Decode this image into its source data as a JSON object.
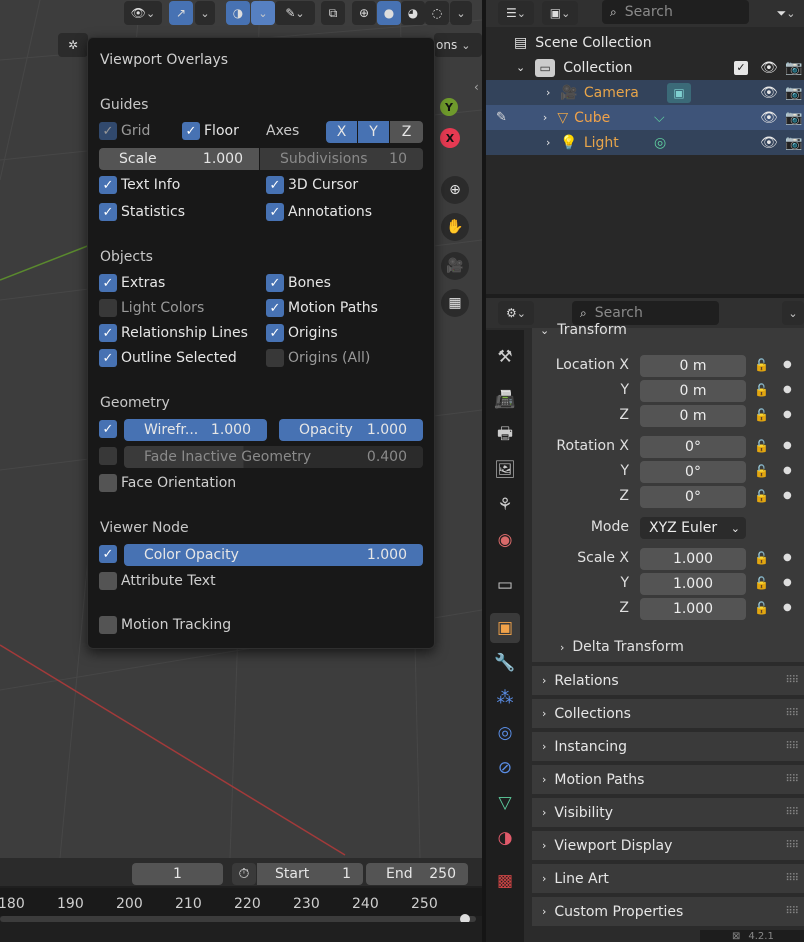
{
  "viewport": {
    "gizmo_y": "Y",
    "gizmo_x": "X",
    "options_label": "ons",
    "colors": {
      "accent": "#4772b3",
      "grid_red": "#a23a3a",
      "grid_green": "#5a8a2e"
    }
  },
  "overlay": {
    "title": "Viewport Overlays",
    "guides": {
      "heading": "Guides",
      "grid": "Grid",
      "floor": "Floor",
      "axes": "Axes",
      "x": "X",
      "y": "Y",
      "z": "Z",
      "scale_label": "Scale",
      "scale_value": "1.000",
      "subdiv_label": "Subdivisions",
      "subdiv_value": "10",
      "text_info": "Text Info",
      "cursor": "3D Cursor",
      "statistics": "Statistics",
      "annotations": "Annotations"
    },
    "objects": {
      "heading": "Objects",
      "extras": "Extras",
      "bones": "Bones",
      "light_colors": "Light Colors",
      "motion_paths": "Motion Paths",
      "relationship_lines": "Relationship Lines",
      "origins": "Origins",
      "outline_selected": "Outline Selected",
      "origins_all": "Origins (All)"
    },
    "geometry": {
      "heading": "Geometry",
      "wire_label": "Wirefr...",
      "wire_value": "1.000",
      "opacity_label": "Opacity",
      "opacity_value": "1.000",
      "fade_label": "Fade Inactive Geometry",
      "fade_value": "0.400",
      "face_orientation": "Face Orientation"
    },
    "viewer": {
      "heading": "Viewer Node",
      "color_opacity_label": "Color Opacity",
      "color_opacity_value": "1.000",
      "attribute_text": "Attribute Text"
    },
    "motion_tracking": "Motion Tracking"
  },
  "outliner": {
    "search_placeholder": "Search",
    "scene_collection": "Scene Collection",
    "collection": "Collection",
    "items": [
      {
        "label": "Camera"
      },
      {
        "label": "Cube"
      },
      {
        "label": "Light"
      }
    ]
  },
  "properties": {
    "search_placeholder": "Search",
    "transform_heading": "Transform",
    "location": {
      "x_label": "Location X",
      "y_label": "Y",
      "z_label": "Z",
      "x": "0 m",
      "y": "0 m",
      "z": "0 m"
    },
    "rotation": {
      "x_label": "Rotation X",
      "y_label": "Y",
      "z_label": "Z",
      "x": "0°",
      "y": "0°",
      "z": "0°"
    },
    "mode_label": "Mode",
    "mode_value": "XYZ Euler",
    "scale": {
      "x_label": "Scale X",
      "y_label": "Y",
      "z_label": "Z",
      "x": "1.000",
      "y": "1.000",
      "z": "1.000"
    },
    "delta_transform": "Delta Transform",
    "panels": [
      "Relations",
      "Collections",
      "Instancing",
      "Motion Paths",
      "Visibility",
      "Viewport Display",
      "Line Art",
      "Custom Properties"
    ]
  },
  "timeline": {
    "current_frame": "1",
    "start_label": "Start",
    "start_value": "1",
    "end_label": "End",
    "end_value": "250",
    "ticks": [
      "180",
      "190",
      "200",
      "210",
      "220",
      "230",
      "240",
      "250"
    ]
  },
  "status": {
    "version": "4.2.1"
  }
}
